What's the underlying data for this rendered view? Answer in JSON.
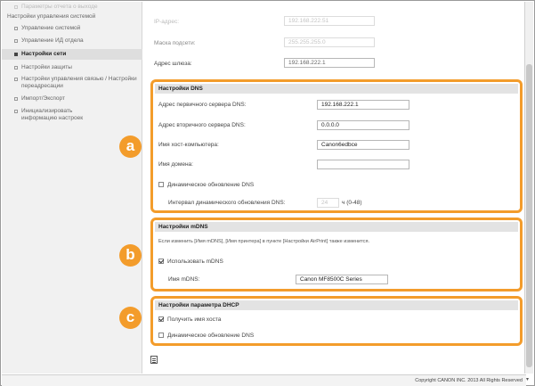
{
  "sidebar": {
    "items": [
      {
        "label": "Параметры отчета о выходе",
        "state": "faded"
      },
      {
        "label": "Настройки управления системой",
        "state": "header"
      },
      {
        "label": "Управление системой",
        "state": "normal"
      },
      {
        "label": "Управление ИД отдела",
        "state": "normal"
      },
      {
        "label": "Настройки сети",
        "state": "active"
      },
      {
        "label": "Настройки защиты",
        "state": "normal"
      },
      {
        "label": "Настройки управления связью / Настройки переадресации",
        "state": "normal"
      },
      {
        "label": "Импорт/Экспорт",
        "state": "normal"
      },
      {
        "label": "Инициализировать информацию настроек",
        "state": "normal"
      }
    ]
  },
  "ip_settings": {
    "ip_label": "IP-адрес:",
    "ip_value": "192.168.222.51",
    "mask_label": "Маска подсети:",
    "mask_value": "255.255.255.0",
    "gateway_label": "Адрес шлюза:",
    "gateway_value": "192.168.222.1"
  },
  "dns": {
    "title": "Настройки DNS",
    "primary_label": "Адрес первичного сервера DNS:",
    "primary_value": "192.168.222.1",
    "secondary_label": "Адрес вторичного сервера DNS:",
    "secondary_value": "0.0.0.0",
    "hostname_label": "Имя хост-компьютера:",
    "hostname_value": "Canon6edbce",
    "domain_label": "Имя домена:",
    "domain_value": "",
    "dynamic_label": "Динамическое обновление DNS",
    "dynamic_checked": false,
    "interval_label": "Интервал динамического обновления DNS:",
    "interval_value": "24",
    "interval_unit": "ч (0-48)"
  },
  "mdns": {
    "title": "Настройки mDNS",
    "note": "Если изменить [Имя mDNS], [Имя принтера] в пункте [Настройки AirPrint] также изменится.",
    "use_label": "Использовать mDNS",
    "use_checked": true,
    "name_label": "Имя mDNS:",
    "name_value": "Canon MF8500C Series"
  },
  "dhcp": {
    "title": "Настройки параметра DHCP",
    "get_host_label": "Получить имя хоста",
    "get_host_checked": true,
    "dynamic_label": "Динамическое обновление DNS",
    "dynamic_checked": false
  },
  "callouts": {
    "a": "a",
    "b": "b",
    "c": "c"
  },
  "footer": {
    "copyright": "Copyright CANON INC. 2013 All Rights Reserved"
  },
  "colors": {
    "accent": "#f39c2b"
  }
}
